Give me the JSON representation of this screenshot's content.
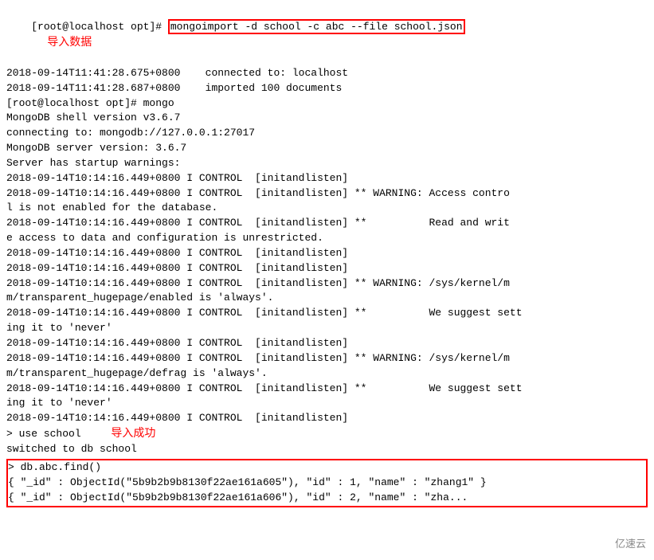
{
  "terminal": {
    "lines": [
      {
        "id": "l1",
        "text": "[root@localhost opt]# mongoimport -d school -c abc --file school.json",
        "highlighted": true
      },
      {
        "id": "l2",
        "text": "2018-09-14T11:41:28.675+0800    connected to: localhost"
      },
      {
        "id": "l3",
        "text": "2018-09-14T11:41:28.687+0800    imported 100 documents"
      },
      {
        "id": "l4",
        "text": "[root@localhost opt]# mongo"
      },
      {
        "id": "l5",
        "text": "MongoDB shell version v3.6.7"
      },
      {
        "id": "l6",
        "text": "connecting to: mongodb://127.0.0.1:27017"
      },
      {
        "id": "l7",
        "text": "MongoDB server version: 3.6.7"
      },
      {
        "id": "l8",
        "text": "Server has startup warnings:"
      },
      {
        "id": "l9",
        "text": "2018-09-14T10:14:16.449+0800 I CONTROL  [initandlisten]"
      },
      {
        "id": "l10",
        "text": "2018-09-14T10:14:16.449+0800 I CONTROL  [initandlisten] ** WARNING: Access control is not enabled for the database."
      },
      {
        "id": "l11",
        "text": "2018-09-14T10:14:16.449+0800 I CONTROL  [initandlisten] **          Read and write access to data and configuration is unrestricted."
      },
      {
        "id": "l12",
        "text": "2018-09-14T10:14:16.449+0800 I CONTROL  [initandlisten]"
      },
      {
        "id": "l13",
        "text": "2018-09-14T10:14:16.449+0800 I CONTROL  [initandlisten]"
      },
      {
        "id": "l14",
        "text": "2018-09-14T10:14:16.449+0800 I CONTROL  [initandlisten] ** WARNING: /sys/kernel/m\nm/transparent_hugepage/enabled is 'always'."
      },
      {
        "id": "l15",
        "text": "2018-09-14T10:14:16.449+0800 I CONTROL  [initandlisten] **          We suggest setting it to 'never'"
      },
      {
        "id": "l16",
        "text": "2018-09-14T10:14:16.449+0800 I CONTROL  [initandlisten]"
      },
      {
        "id": "l17",
        "text": "2018-09-14T10:14:16.449+0800 I CONTROL  [initandlisten] ** WARNING: /sys/kernel/m\nm/transparent_hugepage/defrag is 'always'."
      },
      {
        "id": "l18",
        "text": "2018-09-14T10:14:16.449+0800 I CONTROL  [initandlisten] **          We suggest setting it to 'never'"
      },
      {
        "id": "l19",
        "text": "2018-09-14T10:14:16.449+0800 I CONTROL  [initandlisten]"
      },
      {
        "id": "l20",
        "text": "> use school"
      },
      {
        "id": "l21",
        "text": "switched to db school"
      },
      {
        "id": "l22",
        "text": "> db.abc.find()",
        "boxed": true
      },
      {
        "id": "l23",
        "text": "{ \"_id\" : ObjectId(\"5b9b2b9b8130f22ae161a605\"), \"id\" : 1, \"name\" : \"zhang1\" }",
        "boxed": true
      },
      {
        "id": "l24",
        "text": "{ \"_id\" : ObjectId(\"5b9b2b9b8130f22ae161a606\"), \"id\" : 2, \"name\" : \"zha...",
        "boxed": true
      }
    ],
    "annotations": {
      "import_data": "导入数据",
      "import_success": "导入成功"
    },
    "watermark": "亿速云"
  }
}
